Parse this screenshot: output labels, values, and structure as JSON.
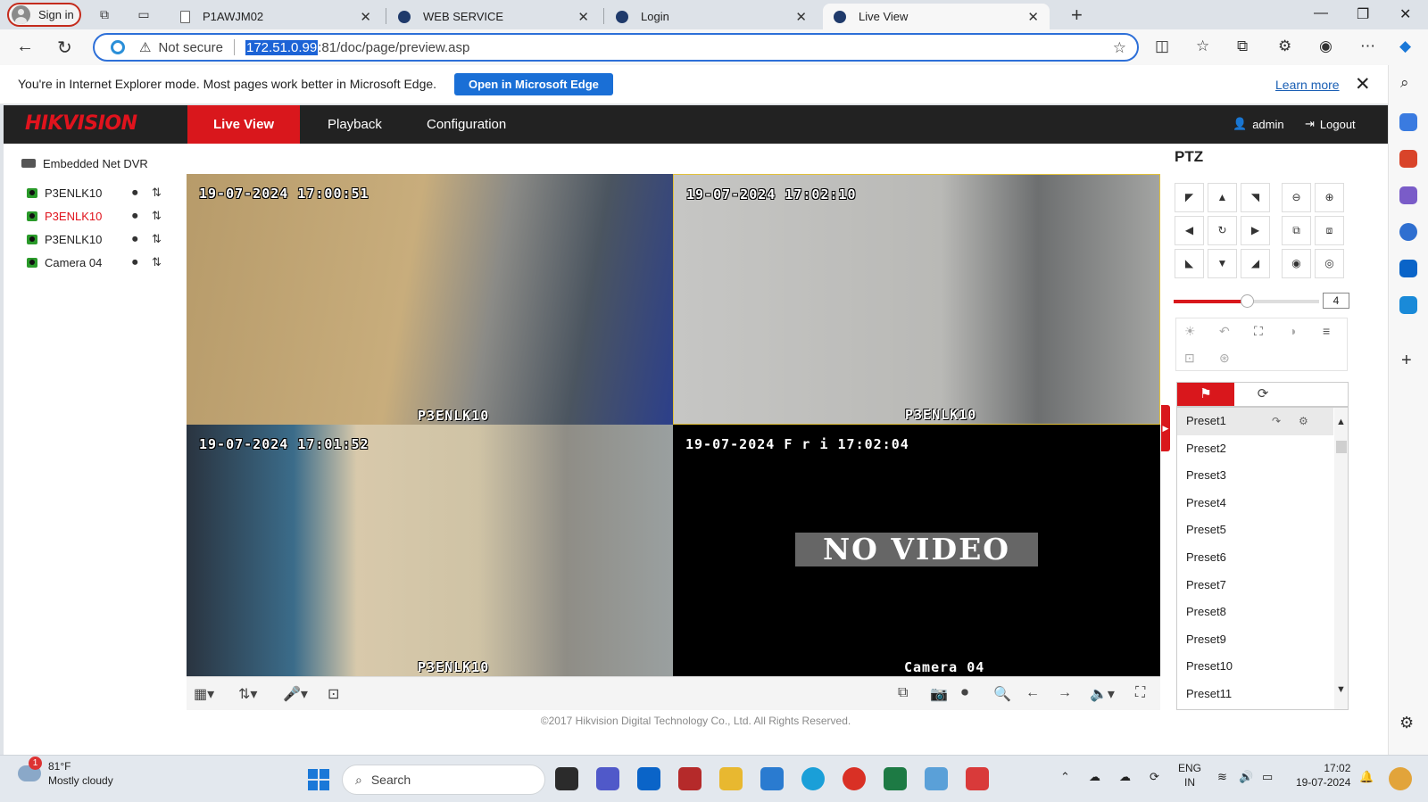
{
  "browser": {
    "signin_label": "Sign in",
    "tabs": [
      {
        "title": "P1AWJM02"
      },
      {
        "title": "WEB SERVICE"
      },
      {
        "title": "Login"
      },
      {
        "title": "Live View"
      }
    ],
    "address": {
      "security_label": "Not secure",
      "host": "172.51.0.99",
      "path": ":81/doc/page/preview.asp"
    },
    "ie_banner": {
      "message": "You're in Internet Explorer mode. Most pages work better in Microsoft Edge.",
      "open_button": "Open in Microsoft Edge",
      "learn_more": "Learn more"
    }
  },
  "app": {
    "brand": "HIKVISION",
    "nav": {
      "live_view": "Live View",
      "playback": "Playback",
      "configuration": "Configuration"
    },
    "user": "admin",
    "logout": "Logout",
    "device": "Embedded Net DVR",
    "cameras": [
      {
        "name": "P3ENLK10"
      },
      {
        "name": "P3ENLK10"
      },
      {
        "name": "P3ENLK10"
      },
      {
        "name": "Camera 04"
      }
    ],
    "tiles": [
      {
        "timestamp": "19-07-2024 17:00:51",
        "name": "P3ENLK10"
      },
      {
        "timestamp": "19-07-2024 17:02:10",
        "name": "P3ENLK10"
      },
      {
        "timestamp": "19-07-2024 17:01:52",
        "name": "P3ENLK10"
      },
      {
        "timestamp": "19-07-2024 F r i 17:02:04",
        "name": "Camera 04",
        "overlay": "NO VIDEO"
      }
    ],
    "footer": "©2017 Hikvision Digital Technology Co., Ltd. All Rights Reserved.",
    "ptz": {
      "title": "PTZ",
      "speed": "4",
      "speed_level": 0.5,
      "presets": [
        "Preset1",
        "Preset2",
        "Preset3",
        "Preset4",
        "Preset5",
        "Preset6",
        "Preset7",
        "Preset8",
        "Preset9",
        "Preset10",
        "Preset11"
      ]
    }
  },
  "taskbar": {
    "weather_temp": "81°F",
    "weather_desc": "Mostly cloudy",
    "weather_badge": "1",
    "search_placeholder": "Search",
    "lang_top": "ENG",
    "lang_bottom": "IN",
    "time": "17:02",
    "date": "19-07-2024"
  },
  "colors": {
    "accent": "#d9171c",
    "edge_blue": "#1a6fd6"
  }
}
